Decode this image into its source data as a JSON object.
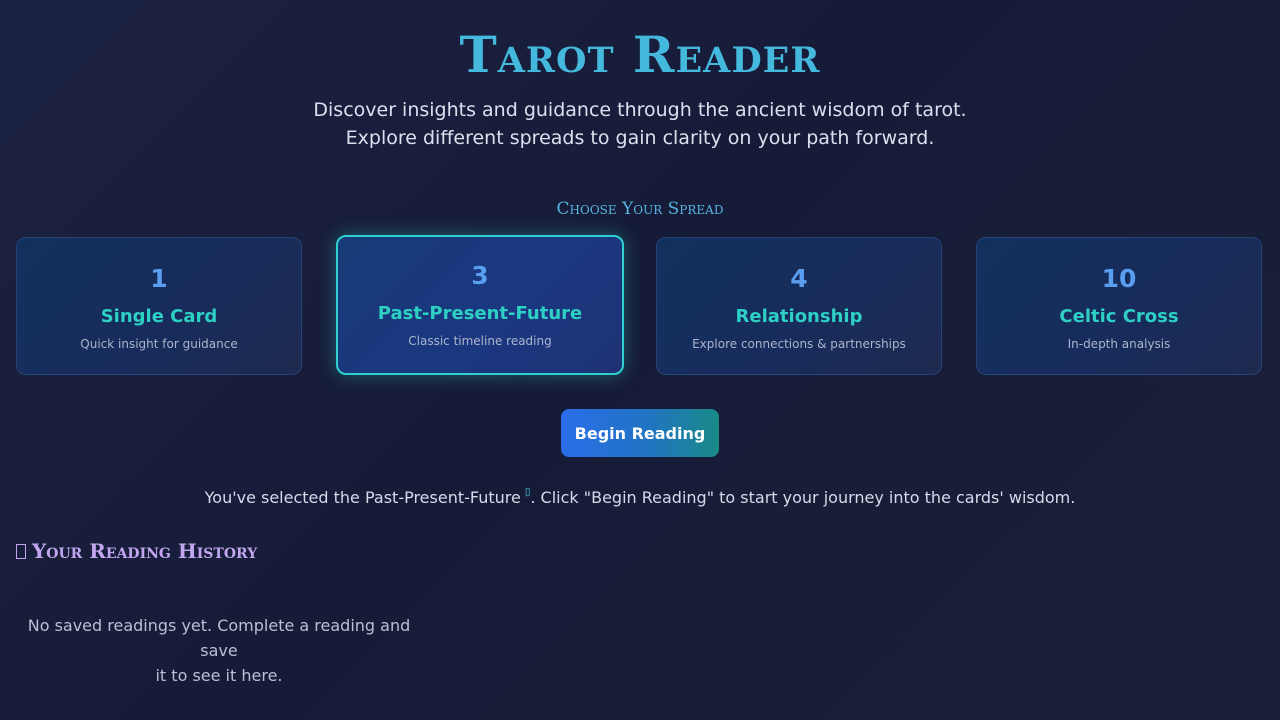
{
  "header": {
    "title": "Tarot Reader",
    "subtitle_line1": "Discover insights and guidance through the ancient wisdom of tarot.",
    "subtitle_line2": "Explore different spreads to gain clarity on your path forward."
  },
  "spreads": {
    "label": "Choose Your Spread",
    "selected_index": 1,
    "items": [
      {
        "count": "1",
        "name": "Single Card",
        "description": "Quick insight for guidance"
      },
      {
        "count": "3",
        "name": "Past-Present-Future",
        "description": "Classic timeline reading"
      },
      {
        "count": "4",
        "name": "Relationship",
        "description": "Explore connections & partnerships"
      },
      {
        "count": "10",
        "name": "Celtic Cross",
        "description": "In-depth analysis"
      }
    ]
  },
  "actions": {
    "begin_label": "Begin Reading"
  },
  "selection": {
    "prefix": "You've selected the Past-Present-Future",
    "cursor_glyph": "▯",
    "suffix": ". Click \"Begin Reading\" to start your journey into the cards' wisdom."
  },
  "history": {
    "heading": "Your Reading History",
    "icon": "book-icon",
    "empty_line1": "No saved readings yet. Complete a reading and save",
    "empty_line2": "it to see it here."
  },
  "colors": {
    "title": "#44b8dd",
    "accent_teal": "#2ed0c4",
    "count_blue": "#5a9ef0",
    "history_purple": "#c3a6f0",
    "background": "#161c38"
  }
}
